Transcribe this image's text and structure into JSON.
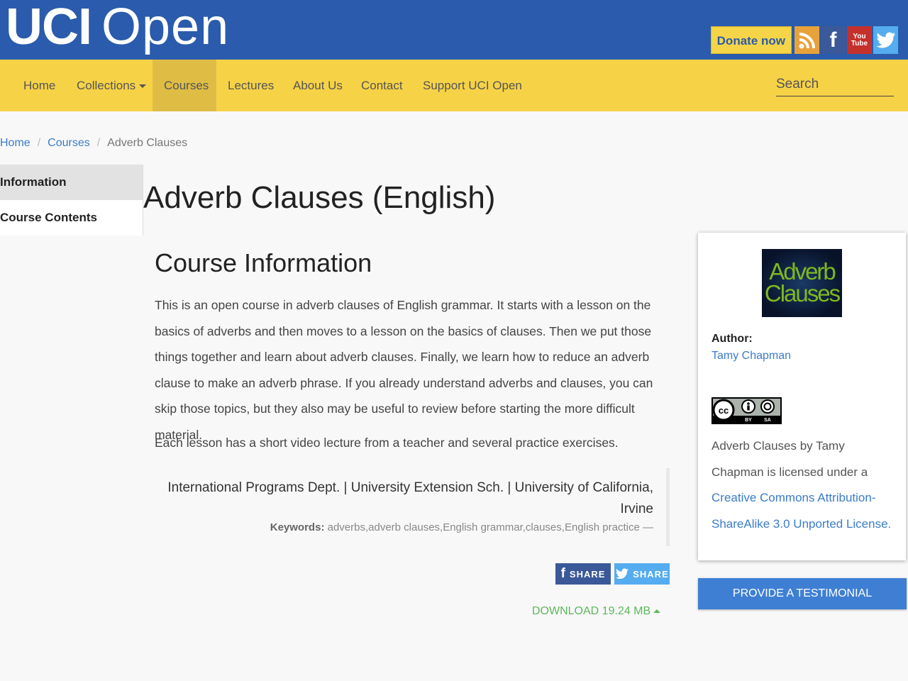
{
  "header": {
    "logo_bold": "UCI",
    "logo_light": "Open",
    "donate_label": "Donate now",
    "social_icons": [
      "rss-icon",
      "facebook-icon",
      "youtube-icon",
      "twitter-icon"
    ],
    "youtube_text": "You Tube",
    "brand_color": "#2a5bac"
  },
  "nav": {
    "items": [
      "Home",
      "Collections",
      "Courses",
      "Lectures",
      "About Us",
      "Contact",
      "Support UCI Open"
    ],
    "active": "Courses",
    "search_label": "Search",
    "bar_color": "#f6d247"
  },
  "breadcrumb": {
    "items": [
      "Home",
      "Courses",
      "Adverb Clauses"
    ],
    "separator": "/"
  },
  "sidetabs": [
    "Information",
    "Course Contents"
  ],
  "page_title": "Adverb Clauses (English)",
  "section_title": "Course Information",
  "description": "This is an open course in adverb clauses of English grammar. It starts with a lesson on the basics of adverbs and then moves to a lesson on the basics of clauses. Then we put those things together and learn about adverb clauses. Finally, we learn how to reduce an adverb clause to make an adverb phrase. If you already understand adverbs and clauses, you can skip those topics, but they also may be useful to review before starting the more difficult material.",
  "description2": "Each lesson has a short video lecture from a teacher and several practice exercises.",
  "affiliation": "International Programs Dept. | University Extension Sch. | University of California, Irvine",
  "keywords": {
    "label": "Keywords:",
    "value": "adverbs,adverb clauses,English grammar,clauses,English practice —"
  },
  "share": {
    "facebook": "SHARE",
    "twitter": "SHARE"
  },
  "download": "DOWNLOAD 19.24 MB",
  "card": {
    "thumb_line1": "Adverb",
    "thumb_line2": "Clauses",
    "author_label": "Author:",
    "author_name": "Tamy Chapman",
    "cc_text": "cc",
    "cc_by": "BY",
    "cc_sa": "SA",
    "license_text": "Adverb Clauses by Tamy Chapman is licensed under a ",
    "license_link": "Creative Commons Attribution-ShareAlike 3.0 Unported License."
  },
  "testimonial": "PROVIDE A TESTIMONIAL"
}
